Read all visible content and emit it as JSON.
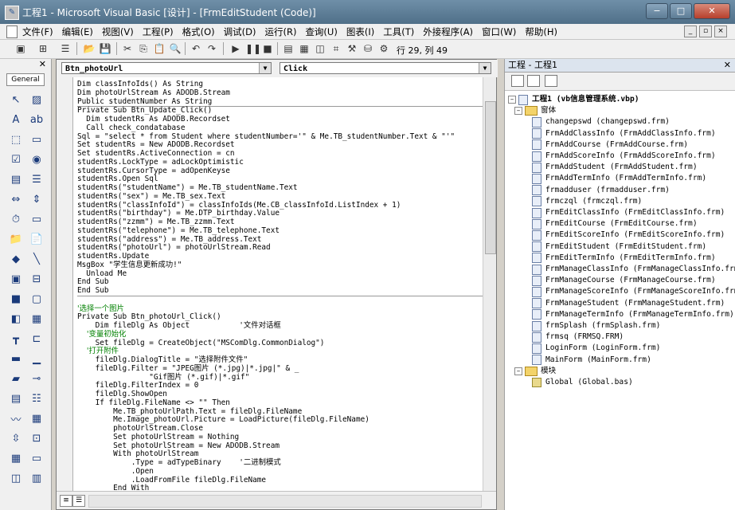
{
  "window": {
    "title": "工程1 - Microsoft Visual Basic [设计] - [FrmEditStudent (Code)]",
    "min_glyph": "−",
    "max_glyph": "□",
    "close_glyph": "✕"
  },
  "menu": [
    "文件(F)",
    "编辑(E)",
    "视图(V)",
    "工程(P)",
    "格式(O)",
    "调试(D)",
    "运行(R)",
    "查询(U)",
    "图表(I)",
    "工具(T)",
    "外接程序(A)",
    "窗口(W)",
    "帮助(H)"
  ],
  "mdi_buttons": [
    "_",
    "▫",
    "×"
  ],
  "toolbar": {
    "position_text": "行 29, 列 49"
  },
  "toolbox": {
    "tab_label": "General",
    "close_glyph": "✕"
  },
  "code_window": {
    "object_combo": "Btn_photoUrl",
    "proc_combo": "Click",
    "lines": [
      "Dim classInfoIds() As String",
      "Dim photoUrlStream As ADODB.Stream",
      "Public studentNumber As String",
      "Private Sub Btn_Update_Click()",
      "  Dim studentRs As ADODB.Recordset",
      "  Call check_condatabase",
      "Sql = \"select * from Student where studentNumber='\" & Me.TB_studentNumber.Text & \"'\"",
      "Set studentRs = New ADODB.Recordset",
      "Set studentRs.ActiveConnection = cn",
      "studentRs.LockType = adLockOptimistic",
      "studentRs.CursorType = adOpenKeyse",
      "studentRs.Open Sql",
      "studentRs(\"studentName\") = Me.TB_studentName.Text",
      "studentRs(\"sex\") = Me.TB_sex.Text",
      "studentRs(\"classInfoId\") = classInfoIds(Me.CB_classInfoId.ListIndex + 1)",
      "studentRs(\"birthday\") = Me.DTP_birthday.Value",
      "studentRs(\"zzmm\") = Me.TB_zzmm.Text",
      "studentRs(\"telephone\") = Me.TB_telephone.Text",
      "studentRs(\"address\") = Me.TB_address.Text",
      "studentRs(\"photoUrl\") = photoUrlStream.Read",
      "studentRs.Update",
      "MsgBox \"学生信息更新成功!\"",
      "  Unload Me",
      "End Sub",
      "End Sub",
      "",
      "'选择一个图片",
      "Private Sub Btn_photoUrl_Click()",
      "    Dim fileDlg As Object           '文件对话框",
      "    '变量初始化",
      "    Set fileDlg = CreateObject(\"MSComDlg.CommonDialog\")",
      "    '打开附件",
      "    fileDlg.DialogTitle = \"选择附件文件\"",
      "    fileDlg.Filter = \"JPEG图片 (*.jpg)|*.jpg|\" & _",
      "                \"Gif图片 (*.gif)|*.gif\"",
      "    fileDlg.FilterIndex = 0",
      "    fileDlg.ShowOpen",
      "    If fileDlg.FileName <> \"\" Then",
      "        Me.TB_photoUrlPath.Text = fileDlg.FileName",
      "        Me.Image_photoUrl.Picture = LoadPicture(fileDlg.FileName)",
      "        photoUrlStream.Close",
      "        Set photoUrlStream = Nothing",
      "        Set photoUrlStream = New ADODB.Stream",
      "        With photoUrlStream",
      "            .Type = adTypeBinary    '二进制模式",
      "            .Open",
      "            .LoadFromFile fileDlg.FileName",
      "        End With"
    ]
  },
  "project": {
    "panel_title": "工程 - 工程1",
    "close_glyph": "✕",
    "root": "工程1 (vb信息管理系统.vbp)",
    "forms_folder": "窗体",
    "forms": [
      "changepswd (changepswd.frm)",
      "FrmAddClassInfo (FrmAddClassInfo.frm)",
      "FrmAddCourse (FrmAddCourse.frm)",
      "FrmAddScoreInfo (FrmAddScoreInfo.frm)",
      "FrmAddStudent (FrmAddStudent.frm)",
      "FrmAddTermInfo (FrmAddTermInfo.frm)",
      "frmadduser (frmadduser.frm)",
      "frmczql (frmczql.frm)",
      "FrmEditClassInfo (FrmEditClassInfo.frm)",
      "FrmEditCourse (FrmEditCourse.frm)",
      "FrmEditScoreInfo (FrmEditScoreInfo.frm)",
      "FrmEditStudent (FrmEditStudent.frm)",
      "FrmEditTermInfo (FrmEditTermInfo.frm)",
      "FrmManageClassInfo (FrmManageClassInfo.frm)",
      "FrmManageCourse (FrmManageCourse.frm)",
      "FrmManageScoreInfo (FrmManageScoreInfo.frm)",
      "FrmManageStudent (FrmManageStudent.frm)",
      "FrmManageTermInfo (FrmManageTermInfo.frm)",
      "frmSplash (frmSplash.frm)",
      "frmsq (FRMSQ.FRM)",
      "LoginForm (LoginForm.frm)",
      "MainForm (MainForm.frm)"
    ],
    "modules_folder": "模块",
    "modules": [
      "Global (Global.bas)"
    ]
  }
}
